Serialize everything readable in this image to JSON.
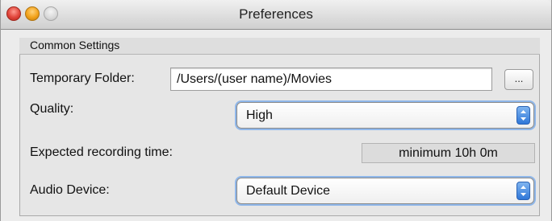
{
  "window": {
    "title": "Preferences"
  },
  "group": {
    "label": "Common Settings"
  },
  "temporary_folder": {
    "label": "Temporary Folder:",
    "value": "/Users/(user name)/Movies",
    "browse_label": "..."
  },
  "quality": {
    "label": "Quality:",
    "selected": "High"
  },
  "expected_recording": {
    "label": "Expected recording time:",
    "value": "minimum 10h 0m"
  },
  "audio_device": {
    "label": "Audio Device:",
    "selected": "Default Device"
  },
  "colors": {
    "accent": "#2f77d8",
    "focus_ring": "#8fb7ea",
    "close": "#e0443a",
    "minimize": "#f2a21a"
  }
}
